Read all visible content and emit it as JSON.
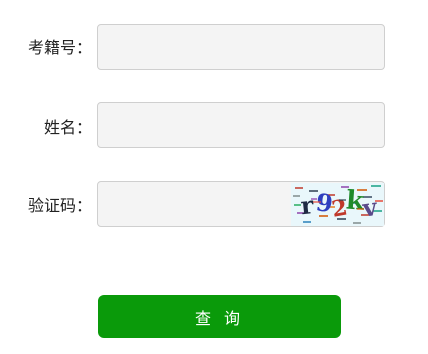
{
  "form": {
    "exam_number_label": "考籍号：",
    "exam_number_value": "",
    "name_label": "姓名：",
    "name_value": "",
    "captcha_label": "验证码：",
    "captcha_value": "",
    "captcha_text": "r92kv",
    "submit_label": "查 询"
  },
  "colors": {
    "submit_bg": "#0a9a0a",
    "field_bg": "#f4f4f4",
    "field_border": "#cfcfcf",
    "captcha_bg": "#e9f7fb"
  }
}
